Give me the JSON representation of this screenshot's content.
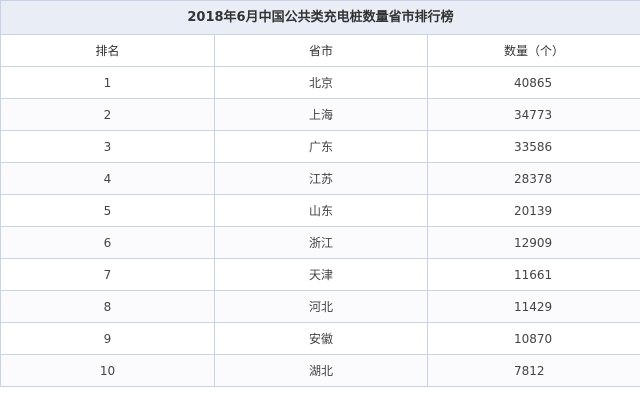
{
  "table": {
    "title": "2018年6月中国公共类充电桩数量省市排行榜",
    "headers": {
      "rank": "排名",
      "city": "省市",
      "count": "数量（个）"
    },
    "rows": [
      {
        "rank": "1",
        "city": "北京",
        "count": "40865"
      },
      {
        "rank": "2",
        "city": "上海",
        "count": "34773"
      },
      {
        "rank": "3",
        "city": "广东",
        "count": "33586"
      },
      {
        "rank": "4",
        "city": "江苏",
        "count": "28378"
      },
      {
        "rank": "5",
        "city": "山东",
        "count": "20139"
      },
      {
        "rank": "6",
        "city": "浙江",
        "count": "12909"
      },
      {
        "rank": "7",
        "city": "天津",
        "count": "11661"
      },
      {
        "rank": "8",
        "city": "河北",
        "count": "11429"
      },
      {
        "rank": "9",
        "city": "安徽",
        "count": "10870"
      },
      {
        "rank": "10",
        "city": "湖北",
        "count": "7812"
      }
    ]
  }
}
